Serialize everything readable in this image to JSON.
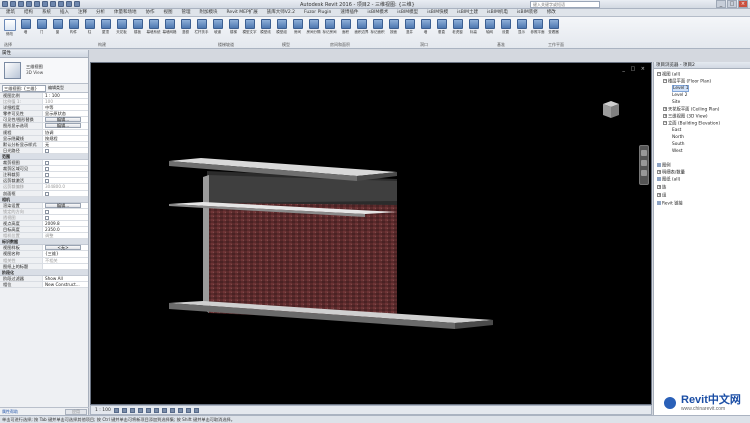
{
  "titlebar": {
    "app_title": "Autodesk Revit 2016 -",
    "doc_title": "项目2 - 三维视图: {三维}",
    "search_placeholder": "键入关键字或短语",
    "minimize": "_",
    "maximize": "□",
    "close": "×"
  },
  "menu_tabs": [
    "建筑",
    "结构",
    "系统",
    "插入",
    "注释",
    "分析",
    "体量和场地",
    "协作",
    "视图",
    "管理",
    "附加模块",
    "Revit MEP扩展",
    "族库大师V2.2",
    "Fuzor Plugin",
    "速博插件",
    "isBIM模术",
    "isBIM模型",
    "isBIM快模",
    "isBIM土建",
    "isBIM机电",
    "isBIM装修",
    "修改"
  ],
  "ribbon": {
    "tools": [
      "修改",
      "墙",
      "门",
      "窗",
      "构件",
      "柱",
      "屋顶",
      "天花板",
      "楼板",
      "幕墙系统",
      "幕墙网格",
      "竖梃",
      "栏杆扶手",
      "坡道",
      "楼梯",
      "模型文字",
      "模型线",
      "模型组",
      "房间",
      "房间分隔",
      "标记房间",
      "面积",
      "面积边界",
      "标记面积",
      "按面",
      "竖井",
      "墙",
      "垂直",
      "老虎窗",
      "标高",
      "轴网",
      "设置",
      "显示",
      "参照平面",
      "查看器"
    ],
    "groups": [
      "选择",
      "构建",
      "楼梯坡道",
      "模型",
      "房间和面积",
      "洞口",
      "基准",
      "工作平面"
    ]
  },
  "properties": {
    "title": "属性",
    "type_name_1": "三维视图",
    "type_name_2": "3D View",
    "selector_value": "三维视图: {三维}",
    "edit_type": "编辑类型",
    "rows": [
      {
        "k": "视图比例",
        "v": "1 : 100"
      },
      {
        "k": "比例值 1:",
        "v": "100",
        "grey": true
      },
      {
        "k": "详细程度",
        "v": "中等"
      },
      {
        "k": "零件可见性",
        "v": "显示原状态"
      },
      {
        "k": "可见性/图形替换",
        "v": "编辑...",
        "btn": true
      },
      {
        "k": "图形显示选项",
        "v": "编辑...",
        "btn": true
      },
      {
        "k": "规程",
        "v": "协调"
      },
      {
        "k": "显示隐藏线",
        "v": "按规程"
      },
      {
        "k": "默认分析显示样式",
        "v": "无"
      },
      {
        "k": "日光路径",
        "v": "",
        "chk": true
      }
    ],
    "section_extents": "范围",
    "extents_rows": [
      {
        "k": "裁剪视图",
        "v": "",
        "chk": true
      },
      {
        "k": "裁剪区域可见",
        "v": "",
        "chk": true
      },
      {
        "k": "注释裁剪",
        "v": "",
        "chk": true
      },
      {
        "k": "远剪裁激活",
        "v": "",
        "chk": true
      },
      {
        "k": "远剪裁偏移",
        "v": "304800.0",
        "grey": true
      },
      {
        "k": "剖面框",
        "v": "",
        "chk": true
      }
    ],
    "section_camera": "相机",
    "camera_rows": [
      {
        "k": "渲染设置",
        "v": "编辑...",
        "btn": true
      },
      {
        "k": "锁定的方向",
        "v": "",
        "chk": true,
        "grey": true
      },
      {
        "k": "透视图",
        "v": "",
        "chk": true,
        "grey": true
      },
      {
        "k": "视点高度",
        "v": "2009.8"
      },
      {
        "k": "目标高度",
        "v": "2350.0"
      },
      {
        "k": "相机位置",
        "v": "调整",
        "grey": true
      }
    ],
    "section_identity": "标识数据",
    "identity_rows": [
      {
        "k": "视图样板",
        "v": "<无>",
        "btn": true
      },
      {
        "k": "视图名称",
        "v": "{三维}"
      },
      {
        "k": "相关性",
        "v": "不相关",
        "grey": true
      },
      {
        "k": "图纸上的标题",
        "v": ""
      }
    ],
    "section_phasing": "阶段化",
    "phasing_rows": [
      {
        "k": "阶段过滤器",
        "v": "Show All"
      },
      {
        "k": "相位",
        "v": "New Construct..."
      }
    ],
    "help_link": "属性帮助",
    "apply": "应用"
  },
  "viewport": {
    "controls": "_ □ ×"
  },
  "viewbar": {
    "scale": "1 : 100"
  },
  "browser": {
    "title": "项目浏览器 - 项目2",
    "views_root": "视图 (all)",
    "floor_plans": "楼层平面 (Floor Plan)",
    "level1": "Level 1",
    "level2": "Level 2",
    "site": "Site",
    "ceiling": "天花板平面 (Ceiling Plan)",
    "view3d": "三维视图 (3D View)",
    "elevations": "立面 (Building Elevation)",
    "east": "East",
    "north": "North",
    "south": "South",
    "west": "West",
    "legends": "图例",
    "schedules": "明细表/数量",
    "sheets": "图纸 (all)",
    "families": "族",
    "groups": "组",
    "links": "Revit 链接"
  },
  "status": {
    "text": "单击可进行选择; 按 Tab 键并单击可选择其他项目; 按 Ctrl 键并单击可将新项目添加到选择集; 按 Shift 键并单击可取消选择。"
  },
  "watermark": {
    "title": "Revit中文网",
    "url": "www.chinarevit.com"
  },
  "colors": {
    "brick": "#5a2a2b",
    "slab": "#8a8a8a",
    "background": "#000000"
  }
}
